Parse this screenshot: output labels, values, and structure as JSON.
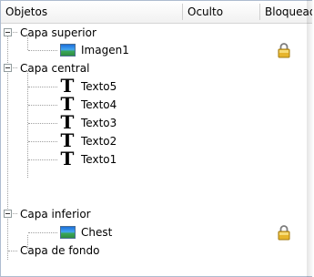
{
  "header": {
    "columns": [
      "Objetos",
      "Oculto",
      "Bloqueado"
    ]
  },
  "tree": {
    "groups": [
      {
        "label": "Capa superior",
        "items": [
          {
            "label": "Imagen1",
            "icon": "image-icon",
            "locked": true
          }
        ]
      },
      {
        "label": "Capa central",
        "items": [
          {
            "label": "Texto5",
            "icon": "text-icon"
          },
          {
            "label": "Texto4",
            "icon": "text-icon"
          },
          {
            "label": "Texto3",
            "icon": "text-icon"
          },
          {
            "label": "Texto2",
            "icon": "text-icon"
          },
          {
            "label": "Texto1",
            "icon": "text-icon"
          }
        ]
      },
      {
        "label": "Capa inferior",
        "items": [
          {
            "label": "Chest",
            "icon": "image-icon",
            "locked": true
          }
        ]
      },
      {
        "label": "Capa de fondo",
        "items": []
      }
    ],
    "text_glyph": "T"
  }
}
